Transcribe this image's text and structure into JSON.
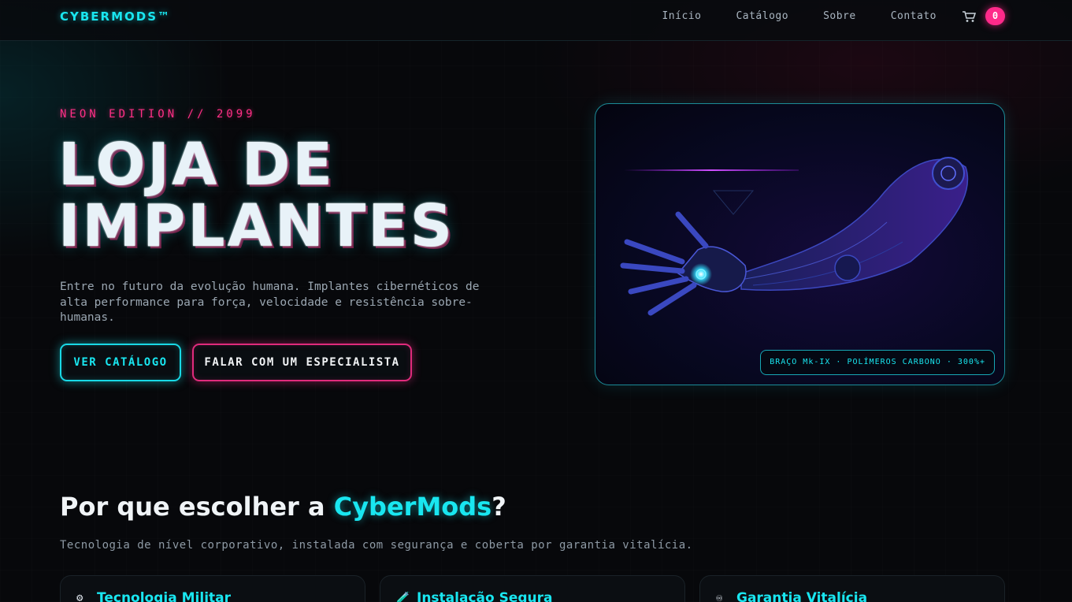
{
  "header": {
    "logo": "CYBERMODS™",
    "nav": [
      "Início",
      "Catálogo",
      "Sobre",
      "Contato"
    ],
    "cart_count": "0"
  },
  "hero": {
    "eyebrow": "NEON EDITION // 2099",
    "title": "LOJA DE IMPLANTES",
    "subtitle": "Entre no futuro da evolução humana. Implantes cibernéticos de alta performance para força, velocidade e resistência sobre-humanas.",
    "primary_cta": "VER CATÁLOGO",
    "secondary_cta": "FALAR COM UM ESPECIALISTA",
    "product_tag": "BRAÇO Mk-IX · POLÍMEROS CARBONO · 300%+"
  },
  "features": {
    "title_prefix": "Por que escolher a ",
    "title_accent": "CyberMods",
    "title_suffix": "?",
    "subtitle": "Tecnologia de nível corporativo, instalada com segurança e coberta por garantia vitalícia.",
    "cards": [
      {
        "icon": "⚙",
        "title": "Tecnologia Militar"
      },
      {
        "icon": "🧪",
        "title": "Instalação Segura"
      },
      {
        "icon": "♾",
        "title": "Garantia Vitalícia"
      }
    ]
  },
  "colors": {
    "accent_cyan": "#19e6f0",
    "accent_pink": "#ff2a8a",
    "background": "#07080b"
  }
}
